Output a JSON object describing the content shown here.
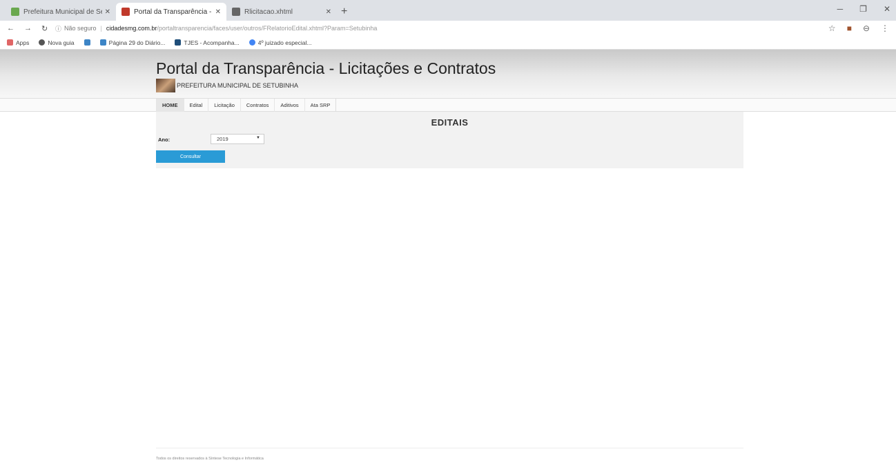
{
  "browser": {
    "tabs": [
      {
        "title": "Prefeitura Municipal de Setubinh",
        "favicon_color": "#6aa84f"
      },
      {
        "title": "Portal da Transparência - Licitaç",
        "favicon_color": "#c0392b"
      },
      {
        "title": "Rlicitacao.xhtml",
        "favicon_color": "#666666"
      }
    ],
    "url": {
      "security": "Não seguro",
      "domain": "cidadesmg.com.br",
      "path": "/portaltransparencia/faces/user/outros/FRelatorioEdital.xhtml?Param=Setubinha"
    },
    "bookmarks": [
      {
        "label": "Apps",
        "color": "#e06666"
      },
      {
        "label": "Nova guia",
        "color": "#555555"
      },
      {
        "label": "",
        "color": "#3d85c6"
      },
      {
        "label": "Página 29 do Diário...",
        "color": "#3d85c6"
      },
      {
        "label": "TJES - Acompanha...",
        "color": "#1f4e79"
      },
      {
        "label": "4º juizado especial...",
        "color": "#4285f4"
      }
    ]
  },
  "header": {
    "title": "Portal da Transparência - Licitações e Contratos",
    "subtitle": "PREFEITURA MUNICIPAL DE SETUBINHA"
  },
  "menu": [
    "HOME",
    "Edital",
    "Licitação",
    "Contratos",
    "Aditivos",
    "Ata SRP"
  ],
  "main": {
    "heading": "EDITAIS",
    "ano_label": "Ano:",
    "ano_value": "2019",
    "button": "Consultar"
  },
  "footer": "Todos os direitos reservados à Síntese Tecnologia e Informática",
  "colors": {
    "accent": "#2a9bd6"
  }
}
